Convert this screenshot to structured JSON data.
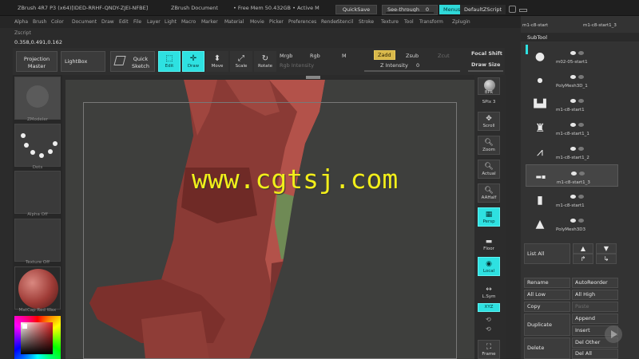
{
  "window": {
    "title": "ZBrush 4R7 P3 (x64)[IDED-RRHF-QNDY-ZJEI-NFBE]",
    "document": "ZBrush Document",
    "mem": "• Free Mem 50.432GB • Active M",
    "quicksave": "QuickSave",
    "see_through_label": "See-through",
    "see_through_value": "0",
    "menus": "Menus",
    "default_zscript": "DefaultZScript"
  },
  "menubar": [
    "Alpha",
    "Brush",
    "Color",
    "Document",
    "Draw",
    "Edit",
    "File",
    "Layer",
    "Light",
    "Macro",
    "Marker",
    "Material",
    "Movie",
    "Picker",
    "Preferences",
    "Render",
    "Stencil",
    "Stroke",
    "Texture",
    "Tool",
    "Transform",
    "Zplugin"
  ],
  "zscript_label": "Zscript",
  "coords": "0.358,0.491,0.162",
  "shelf": {
    "projection_master": "Projection Master",
    "lightbox": "LightBox",
    "quick_sketch": "Quick Sketch",
    "edit": "Edit",
    "draw": "Draw",
    "move": "Move",
    "scale": "Scale",
    "rotate": "Rotate",
    "mrgb": "Mrgb",
    "rgb": "Rgb",
    "m": "M",
    "rgb_intensity": "Rgb Intensity",
    "zadd": "Zadd",
    "zsub": "Zsub",
    "zcut": "Zcut",
    "z_intensity_label": "Z Intensity",
    "z_intensity_value": "0",
    "focal_shift": "Focal Shift",
    "draw_size": "Draw Size"
  },
  "left_tray": {
    "brush": "ZModeler",
    "stroke": "Dots",
    "alpha": "Alpha Off",
    "texture": "Texture Off",
    "material": "MatCap Red Wax"
  },
  "right_tools": {
    "bpr": "BPR",
    "spix_label": "SPix",
    "spix_value": "3",
    "scroll": "Scroll",
    "zoom": "Zoom",
    "actual": "Actual",
    "aahalf": "AAHalf",
    "persp": "Persp",
    "floor": "Floor",
    "local": "Local",
    "lsym": "L.Sym",
    "xyz": "XYZ",
    "frame": "Frame"
  },
  "subtool": {
    "header": "SubTool",
    "top_items": [
      "m1-c8-start",
      "m1-c8-start1_3"
    ],
    "items": [
      {
        "name": "m02-05-start1",
        "icon": "head-icon"
      },
      {
        "name": "PolyMesh3D_1",
        "icon": "sphere-icon"
      },
      {
        "name": "m1-c8-start1",
        "icon": "hands-icon"
      },
      {
        "name": "m1-c8-start1_1",
        "icon": "torso-icon"
      },
      {
        "name": "m1-c8-start1_2",
        "icon": "legs-icon"
      },
      {
        "name": "m1-c8-start1_3",
        "icon": "arm-icon"
      },
      {
        "name": "m1-c8-start1",
        "icon": "leg-icon"
      },
      {
        "name": "PolyMesh3D3",
        "icon": "bust-icon"
      }
    ],
    "list_all": "List All",
    "rename": "Rename",
    "auto_reorder": "AutoReorder",
    "all_low": "All Low",
    "all_high": "All High",
    "copy": "Copy",
    "paste": "Paste",
    "duplicate": "Duplicate",
    "append": "Append",
    "insert": "Insert",
    "delete": "Delete",
    "del_other": "Del Other",
    "del_all": "Del All"
  },
  "watermark": "www.cgtsj.com",
  "colors": {
    "accent": "#2ee1e1",
    "zadd": "#d8b84a",
    "model": "#8a3a35",
    "watermark": "#f2ee1a"
  }
}
